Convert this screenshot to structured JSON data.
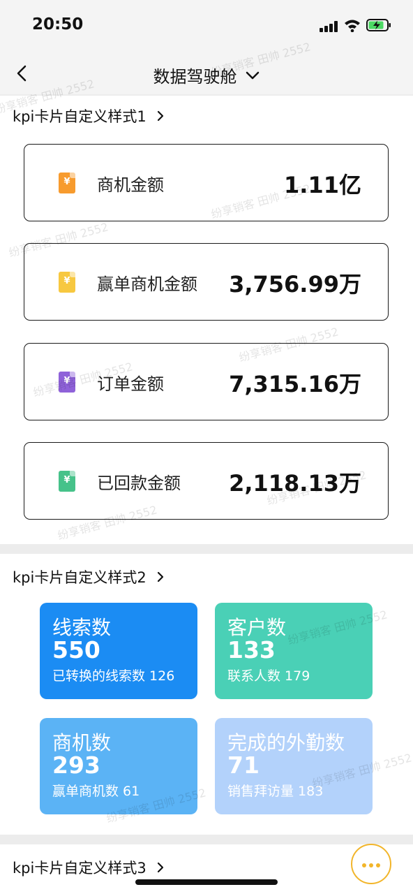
{
  "status_bar": {
    "time": "20:50"
  },
  "nav": {
    "title": "数据驾驶舱"
  },
  "section1": {
    "title": "kpi卡片自定义样式1",
    "cards": [
      {
        "icon": "yuan-document-icon",
        "icon_glyph": "¥",
        "color": "#f79b2e",
        "label": "商机金额",
        "value": "1.11亿"
      },
      {
        "icon": "yuan-document-icon",
        "icon_glyph": "¥",
        "color": "#f7c840",
        "label": "赢单商机金额",
        "value": "3,756.99万"
      },
      {
        "icon": "yuan-document-icon",
        "icon_glyph": "¥",
        "color": "#8f62d9",
        "label": "订单金额",
        "value": "7,315.16万"
      },
      {
        "icon": "yuan-document-icon",
        "icon_glyph": "¥",
        "color": "#46c28a",
        "label": "已回款金额",
        "value": "2,118.13万"
      }
    ]
  },
  "section2": {
    "title": "kpi卡片自定义样式2",
    "tiles": [
      {
        "title": "线索数",
        "value": "550",
        "sub": "已转换的线索数 126",
        "color": "#1b8cf3"
      },
      {
        "title": "客户数",
        "value": "133",
        "sub": "联系人数 179",
        "color": "#4ad0b6"
      },
      {
        "title": "商机数",
        "value": "293",
        "sub": "赢单商机数 61",
        "color": "#5bb3f5"
      },
      {
        "title": "完成的外勤数",
        "value": "71",
        "sub": "销售拜访量 183",
        "color": "#b3d2fb"
      }
    ]
  },
  "section3": {
    "title": "kpi卡片自定义样式3"
  },
  "watermark": "纷享销客 田帅 2552",
  "colors": {
    "accent": "#f2b52a",
    "background": "#ececec"
  }
}
